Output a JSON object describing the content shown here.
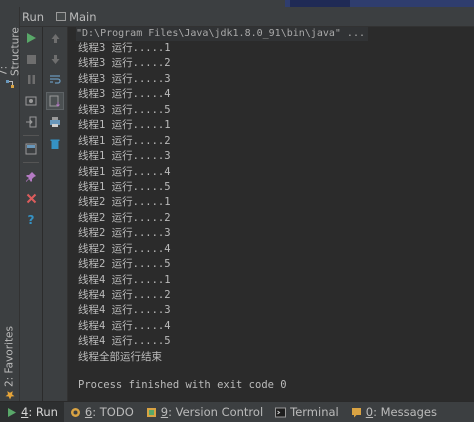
{
  "run_panel": {
    "label": "Run",
    "tab_label": "Main"
  },
  "left_strip": {
    "structure_label": "7: Structure",
    "favorites_label": "2: Favorites"
  },
  "console": {
    "command": "\"D:\\Program Files\\Java\\jdk1.8.0_91\\bin\\java\" ...",
    "lines": [
      "线程3 运行.....1",
      "线程3 运行.....2",
      "线程3 运行.....3",
      "线程3 运行.....4",
      "线程3 运行.....5",
      "线程1 运行.....1",
      "线程1 运行.....2",
      "线程1 运行.....3",
      "线程1 运行.....4",
      "线程1 运行.....5",
      "线程2 运行.....1",
      "线程2 运行.....2",
      "线程2 运行.....3",
      "线程2 运行.....4",
      "线程2 运行.....5",
      "线程4 运行.....1",
      "线程4 运行.....2",
      "线程4 运行.....3",
      "线程4 运行.....4",
      "线程4 运行.....5",
      "线程全部运行结束"
    ],
    "finish_message": "Process finished with exit code 0"
  },
  "bottom_bar": {
    "tabs": [
      {
        "num": "4",
        "text": ": Run",
        "icon": "run-icon"
      },
      {
        "num": "6",
        "text": ": TODO",
        "icon": "todo-icon"
      },
      {
        "num": "9",
        "text": ": Version Control",
        "icon": "version-control-icon"
      },
      {
        "num": "",
        "text": "Terminal",
        "icon": "terminal-icon"
      },
      {
        "num": "0",
        "text": ": Messages",
        "icon": "messages-icon"
      }
    ]
  },
  "colors": {
    "background": "#2b2b2b",
    "panel": "#3c3f41",
    "text": "#bbbbbb",
    "run_green": "#59a869",
    "close_red": "#db5c5c",
    "help_blue": "#3592c4"
  }
}
